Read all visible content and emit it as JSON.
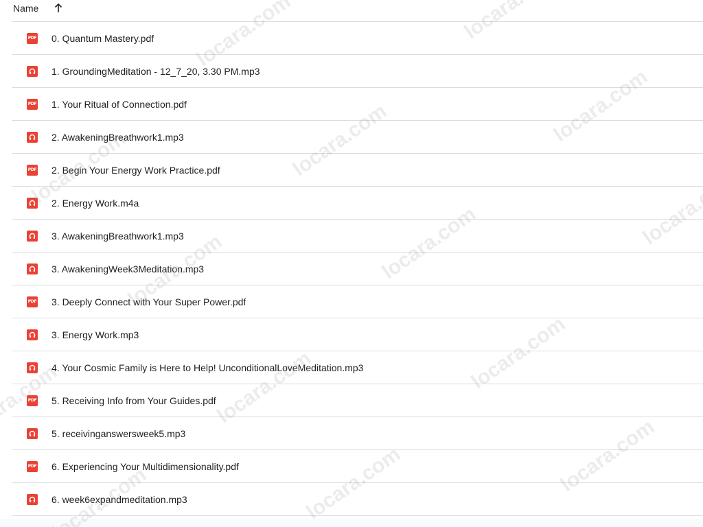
{
  "header": {
    "name_label": "Name",
    "sort_icon": "arrow-up-icon"
  },
  "files": [
    {
      "name": "0. Quantum Mastery.pdf",
      "type": "pdf"
    },
    {
      "name": "1. GroundingMeditation - 12_7_20, 3.30 PM.mp3",
      "type": "audio"
    },
    {
      "name": "1. Your Ritual of Connection.pdf",
      "type": "pdf"
    },
    {
      "name": "2. AwakeningBreathwork1.mp3",
      "type": "audio"
    },
    {
      "name": "2. Begin Your Energy Work Practice.pdf",
      "type": "pdf"
    },
    {
      "name": "2. Energy Work.m4a",
      "type": "audio"
    },
    {
      "name": "3. AwakeningBreathwork1.mp3",
      "type": "audio"
    },
    {
      "name": "3. AwakeningWeek3Meditation.mp3",
      "type": "audio"
    },
    {
      "name": "3. Deeply Connect with Your Super Power.pdf",
      "type": "pdf"
    },
    {
      "name": "3. Energy Work.mp3",
      "type": "audio"
    },
    {
      "name": "4. Your Cosmic Family is Here to Help! UnconditionalLoveMeditation.mp3",
      "type": "audio"
    },
    {
      "name": "5. Receiving Info from Your Guides.pdf",
      "type": "pdf"
    },
    {
      "name": "5. receivinganswersweek5.mp3",
      "type": "audio"
    },
    {
      "name": "6. Experiencing Your Multidimensionality.pdf",
      "type": "pdf"
    },
    {
      "name": "6. week6expandmeditation.mp3",
      "type": "audio"
    }
  ],
  "icons": {
    "pdf": {
      "name": "pdf-file-icon",
      "label": "PDF"
    },
    "audio": {
      "name": "audio-file-icon"
    }
  },
  "colors": {
    "file_icon": "#e94235",
    "divider": "#dadce0",
    "text": "#1f1f1f"
  },
  "watermark": {
    "text": "locara.com"
  }
}
